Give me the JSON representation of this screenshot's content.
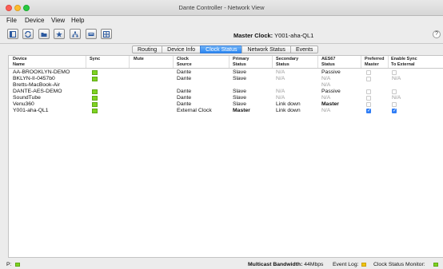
{
  "window": {
    "title": "Dante Controller - Network View"
  },
  "menu": [
    "File",
    "Device",
    "View",
    "Help"
  ],
  "toolbar": {
    "icons": [
      "view-icon",
      "refresh-icon",
      "open-icon",
      "star-icon",
      "network-icon",
      "device-icon",
      "grid-icon"
    ],
    "master_clock_label": "Master Clock:",
    "master_clock_value": "Y001-aha-QL1",
    "help": "?"
  },
  "tabs": [
    {
      "label": "Routing",
      "active": false
    },
    {
      "label": "Device Info",
      "active": false
    },
    {
      "label": "Clock Status",
      "active": true
    },
    {
      "label": "Network Status",
      "active": false
    },
    {
      "label": "Events",
      "active": false
    }
  ],
  "table": {
    "headers": {
      "device": [
        "Device",
        "Name"
      ],
      "sync": [
        "Sync"
      ],
      "mute": [
        "Mute"
      ],
      "clock_source": [
        "Clock",
        "Source"
      ],
      "primary": [
        "Primary",
        "Status"
      ],
      "secondary": [
        "Secondary",
        "Status"
      ],
      "aes67": [
        "AES67",
        "Status"
      ],
      "preferred": [
        "Preferred",
        "Master"
      ],
      "enable_sync": [
        "Enable Sync",
        "To External"
      ]
    },
    "rows": [
      {
        "name": "AA-BROOKLYN-DEMO",
        "sync": true,
        "clock_source": "Dante",
        "primary": "Slave",
        "secondary": "N/A",
        "aes67": "Passive",
        "preferred": false,
        "enable_sync": false,
        "enable_sync_text": ""
      },
      {
        "name": "BKLYN-II-0457b0",
        "sync": true,
        "clock_source": "Dante",
        "primary": "Slave",
        "secondary": "N/A",
        "aes67": "N/A",
        "preferred": false,
        "enable_sync": false,
        "enable_sync_text": "N/A"
      },
      {
        "name": "Bretts-MacBook-Air",
        "sync": false,
        "clock_source": "",
        "primary": "",
        "secondary": "",
        "aes67": "N/A",
        "preferred": null,
        "enable_sync": null,
        "enable_sync_text": ""
      },
      {
        "name": "DANTE-AES-DEMO",
        "sync": true,
        "clock_source": "Dante",
        "primary": "Slave",
        "secondary": "N/A",
        "aes67": "Passive",
        "preferred": false,
        "enable_sync": false,
        "enable_sync_text": ""
      },
      {
        "name": "SoundTube",
        "sync": true,
        "clock_source": "Dante",
        "primary": "Slave",
        "secondary": "N/A",
        "aes67": "N/A",
        "preferred": false,
        "enable_sync": false,
        "enable_sync_text": "N/A"
      },
      {
        "name": "Venu360",
        "sync": true,
        "clock_source": "Dante",
        "primary": "Slave",
        "secondary": "Link down",
        "aes67": "Master",
        "preferred": false,
        "enable_sync": false,
        "enable_sync_text": ""
      },
      {
        "name": "Y001-aha-QL1",
        "sync": true,
        "clock_source": "External Clock",
        "primary": "Master",
        "secondary": "Link down",
        "aes67": "N/A",
        "preferred": true,
        "enable_sync": true,
        "enable_sync_text": ""
      }
    ]
  },
  "statusbar": {
    "p_label": "P:",
    "bandwidth_label": "Multicast Bandwidth:",
    "bandwidth_value": "44Mbps",
    "event_log_label": "Event Log:",
    "clock_monitor_label": "Clock Status Monitor:",
    "colors": {
      "green": "#7ed321",
      "yellow": "#f1c40f"
    }
  }
}
